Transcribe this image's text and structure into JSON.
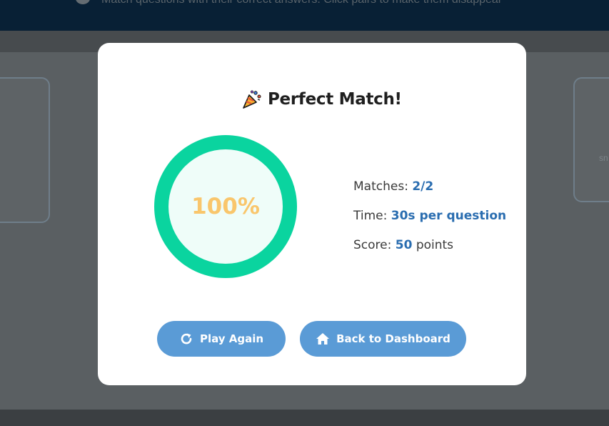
{
  "background": {
    "instruction": "Match questions with their correct answers. Click pairs to make them disappear",
    "right_card_snippet": "sn"
  },
  "modal": {
    "title": "Perfect Match!",
    "title_icon": "party-popper-icon",
    "percent": "100%",
    "progress_fraction": 1.0,
    "stats": {
      "matches_label": "Matches:",
      "matches_value": "2/2",
      "time_label": "Time:",
      "time_value": "30s per question",
      "score_label": "Score:",
      "score_value": "50",
      "score_unit": "points"
    },
    "buttons": {
      "play_again": "Play Again",
      "play_again_icon": "refresh-icon",
      "back": "Back to Dashboard",
      "back_icon": "home-icon"
    }
  },
  "colors": {
    "ring": "#0ad49f",
    "percent": "#f9c66c",
    "accent_value": "#2a6db0",
    "button": "#5a9bd6"
  }
}
